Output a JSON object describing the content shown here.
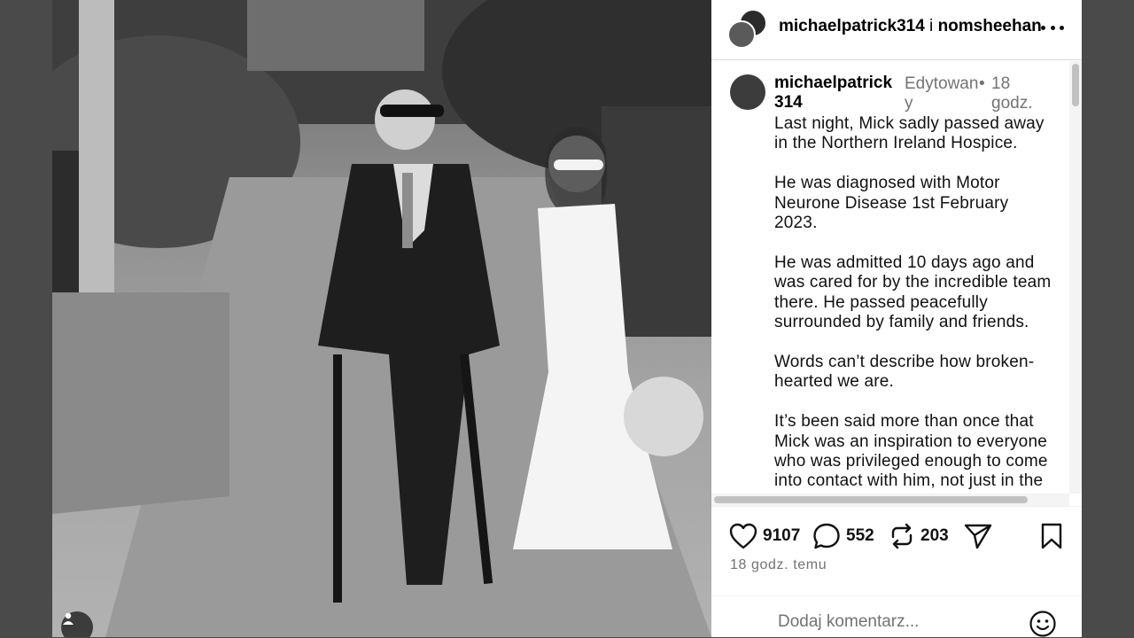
{
  "post": {
    "header_user1": "michaelpatrick314",
    "header_joiner": "i",
    "header_user2": "nomsheehan"
  },
  "caption": {
    "username": "michaelpatrick314",
    "edited": "Edytowany",
    "dot": "•",
    "time": "18 godz.",
    "text": "Last night, Mick sadly passed away in the Northern Ireland Hospice.\n\nHe was diagnosed with Motor Neurone Disease 1st February 2023.\n\nHe was admitted 10 days ago and was cared for by the incredible team there. He passed peacefully surrounded by family and friends.\n\nWords can’t describe how broken-hearted we are.\n\nIt’s been said more than once that Mick was an inspiration to everyone who was privileged enough to come into contact with him, not just in the past few years during his illness but in"
  },
  "stats": {
    "likes": "9107",
    "comments": "552",
    "reposts": "203"
  },
  "footer": {
    "time_ago": "18 godz. temu",
    "comment_placeholder": "Dodaj komentarz..."
  },
  "icons": {
    "like": "heart-icon",
    "comment": "comment-icon",
    "repost": "repost-icon",
    "share": "send-icon",
    "save": "bookmark-icon",
    "more": "more-icon",
    "emoji": "emoji-icon",
    "tagged": "user-tag-icon"
  }
}
